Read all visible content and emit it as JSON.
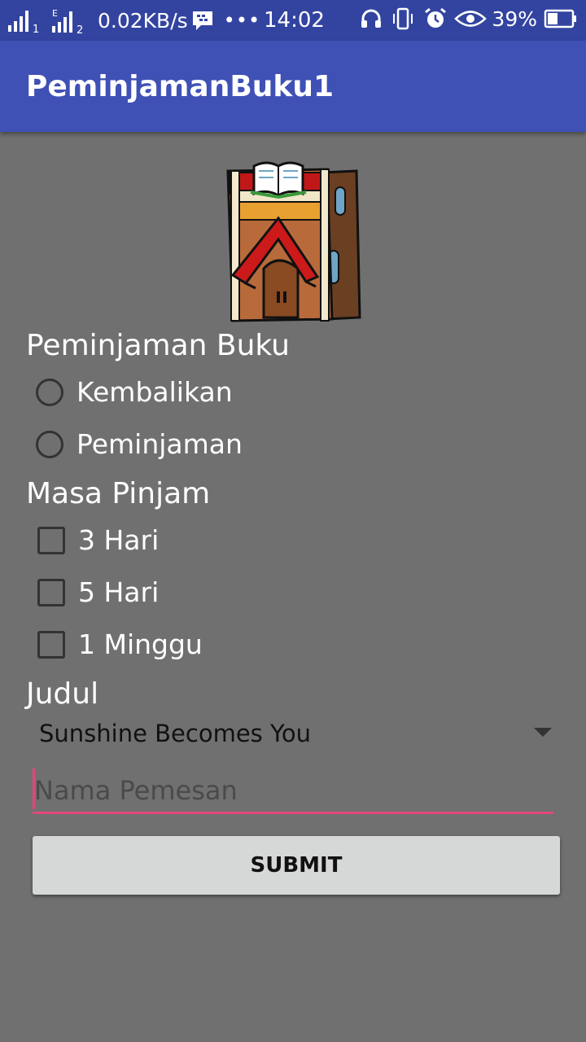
{
  "status_bar": {
    "data_speed": "0.02KB/s",
    "time": "14:02",
    "battery": "39%",
    "icons": [
      "signal-sim1-icon",
      "signal-sim2-icon",
      "bbm-icon",
      "more-icon",
      "headset-icon",
      "vibrate-icon",
      "alarm-icon",
      "eye-icon",
      "battery-icon"
    ]
  },
  "app_bar": {
    "title": "PeminjamanBuku1"
  },
  "logo": {
    "icon": "library-building-icon"
  },
  "peminjaman": {
    "label": "Peminjaman Buku",
    "options": [
      {
        "label": "Kembalikan",
        "checked": false
      },
      {
        "label": "Peminjaman",
        "checked": false
      }
    ]
  },
  "masa": {
    "label": "Masa Pinjam",
    "options": [
      {
        "label": "3 Hari",
        "checked": false
      },
      {
        "label": "5 Hari",
        "checked": false
      },
      {
        "label": "1 Minggu",
        "checked": false
      }
    ]
  },
  "judul": {
    "label": "Judul",
    "selected": "Sunshine Becomes You"
  },
  "nama": {
    "placeholder": "Nama Pemesan",
    "value": ""
  },
  "submit": {
    "label": "SUBMIT"
  },
  "colors": {
    "status_bar": "#3344a0",
    "app_bar": "#3f51b5",
    "background": "#707070",
    "accent": "#e0487d",
    "button": "#d6d7d7"
  }
}
